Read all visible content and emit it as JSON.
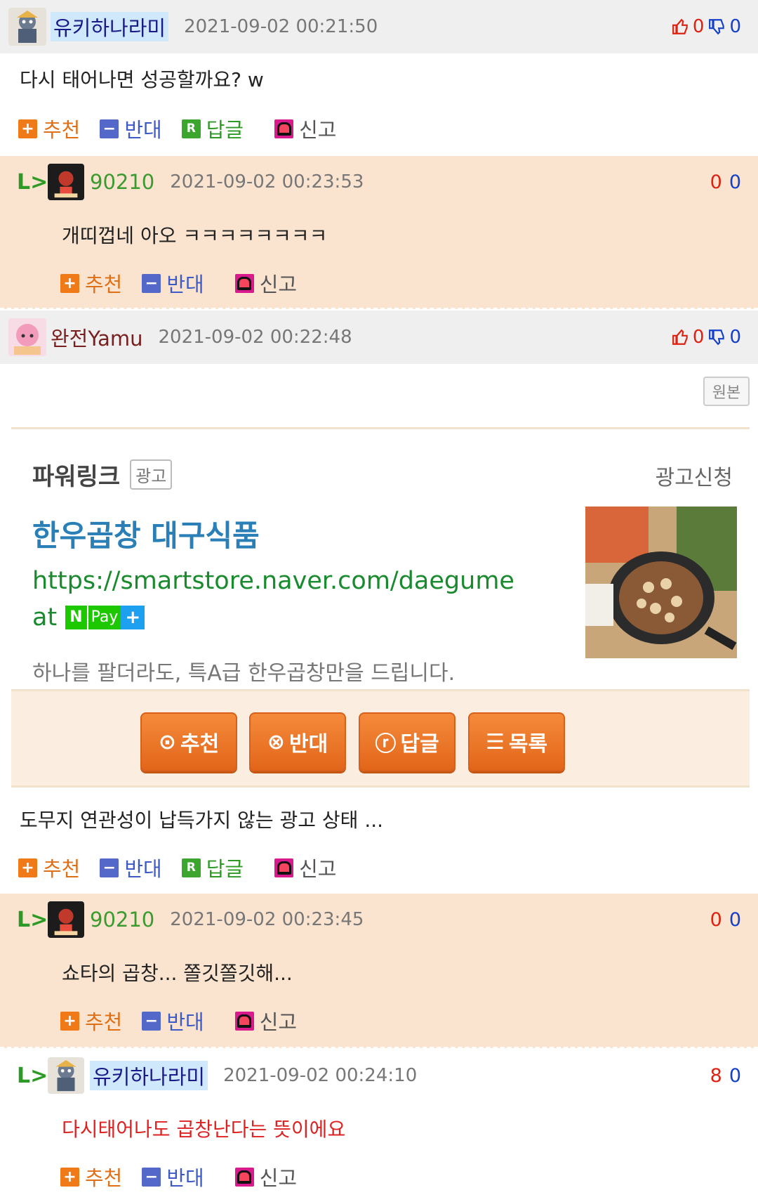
{
  "comments": [
    {
      "nick": "유키하나라미",
      "time": "2021-09-02 00:21:50",
      "up": "0",
      "down": "0",
      "text": "다시 태어나면 성공할까요? w",
      "actions": {
        "recommend": "추천",
        "oppose": "반대",
        "reply": "답글",
        "report": "신고"
      }
    },
    {
      "nick": "완전Yamu",
      "time": "2021-09-02 00:22:48",
      "up": "0",
      "down": "0",
      "original_label": "원본",
      "text": "도무지 연관성이 납득가지 않는 광고 상태 ...",
      "actions": {
        "recommend": "추천",
        "oppose": "반대",
        "reply": "답글",
        "report": "신고"
      }
    }
  ],
  "replies": [
    {
      "nick": "90210",
      "time": "2021-09-02 00:23:53",
      "score_a": "0",
      "score_b": "0",
      "text": "개띠껍네 아오 ㅋㅋㅋㅋㅋㅋㅋㅋ",
      "actions": {
        "recommend": "추천",
        "oppose": "반대",
        "report": "신고"
      }
    },
    {
      "nick": "90210",
      "time": "2021-09-02 00:23:45",
      "score_a": "0",
      "score_b": "0",
      "text": "쇼타의 곱창... 쫄깃쫄깃해...",
      "actions": {
        "recommend": "추천",
        "oppose": "반대",
        "report": "신고"
      }
    },
    {
      "nick": "유키하나라미",
      "time": "2021-09-02 00:24:10",
      "score_a": "8",
      "score_b": "0",
      "text": "다시태어나도 곱창난다는 뜻이에요",
      "actions": {
        "recommend": "추천",
        "oppose": "반대",
        "report": "신고"
      }
    }
  ],
  "ad": {
    "powerlink": "파워링크",
    "ad_badge": "광고",
    "apply": "광고신청",
    "title": "한우곱창 대구식품",
    "url_line1": "https://smartstore.naver.com/daegume",
    "url_line2": "at",
    "npay_n": "N",
    "npay_pay": "Pay",
    "npay_plus": "+",
    "desc": "하나를 팔더라도, 특A급 한우곱창만을 드립니다."
  },
  "board_buttons": {
    "recommend": "추천",
    "oppose": "반대",
    "reply": "답글",
    "list": "목록"
  },
  "colors": {
    "header_bg": "#efefef",
    "reply_bg": "#fae4cf",
    "recommend": "#f07a18",
    "oppose": "#5468c9",
    "reply": "#3ca52e",
    "ad_title": "#2a7fb6",
    "ad_url": "#198a2d"
  }
}
